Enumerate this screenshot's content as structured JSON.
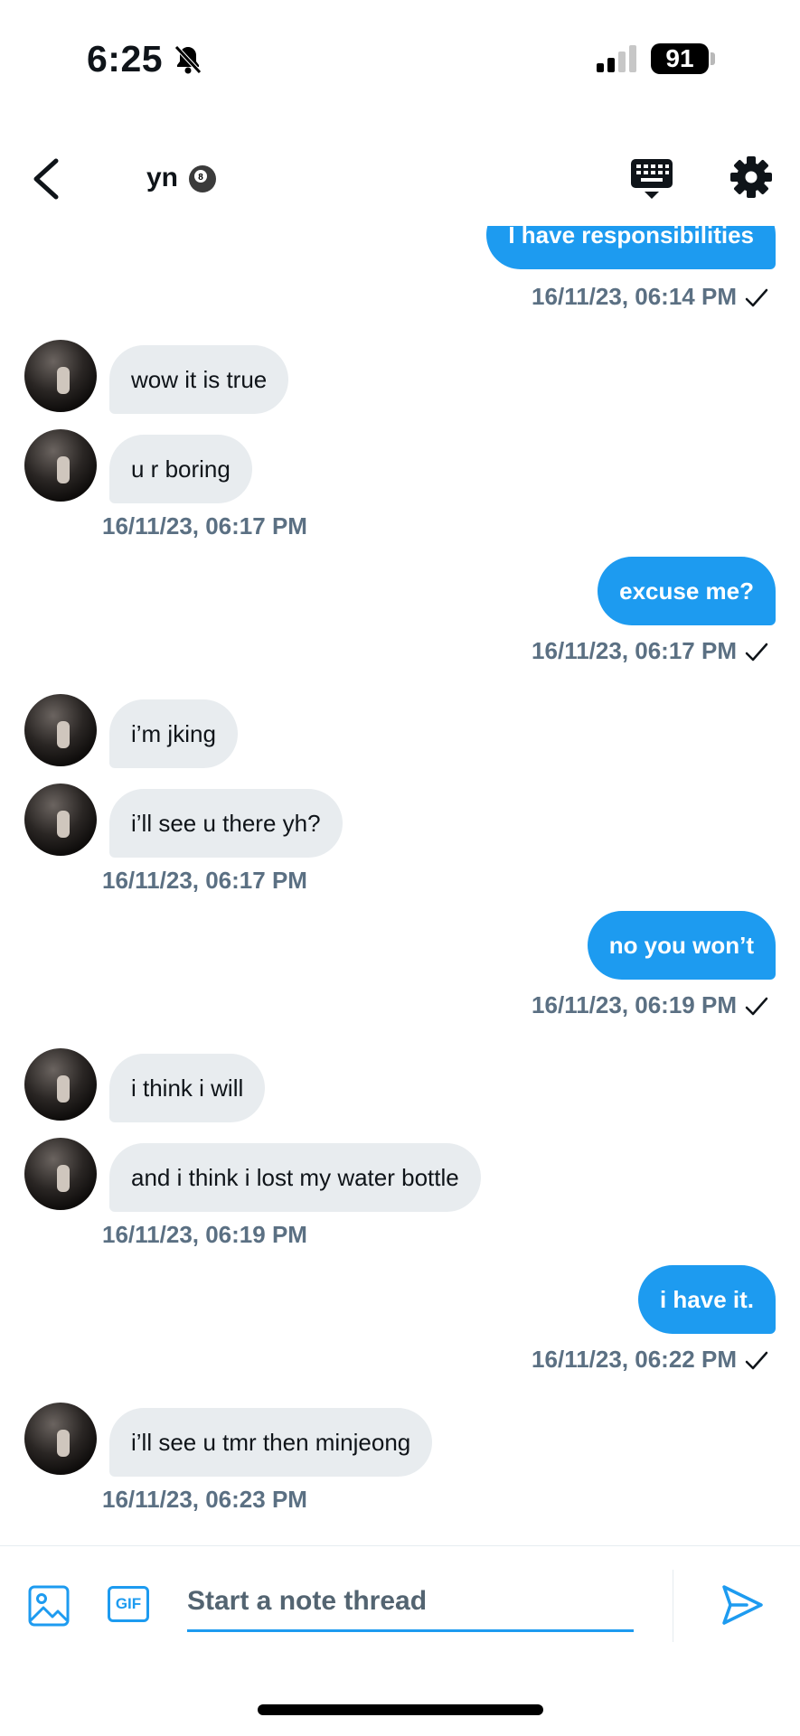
{
  "status_bar": {
    "time": "6:25",
    "battery": "91",
    "icons": [
      "bell-slash-icon",
      "signal-icon",
      "battery-icon"
    ]
  },
  "header": {
    "title": "yn",
    "title_emoji": "pool-8-ball-icon",
    "icons": [
      "back-chevron-icon",
      "keyboard-icon",
      "gear-icon"
    ]
  },
  "messages": [
    {
      "dir": "out",
      "text": "I have responsibilities",
      "time": "16/11/23, 06:14 PM",
      "read": true
    },
    {
      "dir": "in",
      "text": "wow it is true"
    },
    {
      "dir": "in",
      "text": "u r boring",
      "time": "16/11/23, 06:17 PM"
    },
    {
      "dir": "out",
      "text": "excuse me?",
      "time": "16/11/23, 06:17 PM",
      "read": true
    },
    {
      "dir": "in",
      "text": "i’m jking"
    },
    {
      "dir": "in",
      "text": "i’ll see u there yh?",
      "time": "16/11/23, 06:17 PM"
    },
    {
      "dir": "out",
      "text": "no you won’t",
      "time": "16/11/23, 06:19 PM",
      "read": true
    },
    {
      "dir": "in",
      "text": "i think i will"
    },
    {
      "dir": "in",
      "text": "and i think i lost my water bottle",
      "time": "16/11/23, 06:19 PM"
    },
    {
      "dir": "out",
      "text": "i have it.",
      "time": "16/11/23, 06:22 PM",
      "read": true
    },
    {
      "dir": "in",
      "text": "i’ll see u tmr then minjeong",
      "time": "16/11/23, 06:23 PM"
    }
  ],
  "composer": {
    "gif_label": "GIF",
    "placeholder": "Start a note thread",
    "value": "",
    "icons": [
      "image-icon",
      "gif-icon",
      "send-icon"
    ]
  },
  "colors": {
    "accent": "#1d9bf0",
    "incoming_bubble": "#e8ecef",
    "timestamp": "#5b7083"
  }
}
